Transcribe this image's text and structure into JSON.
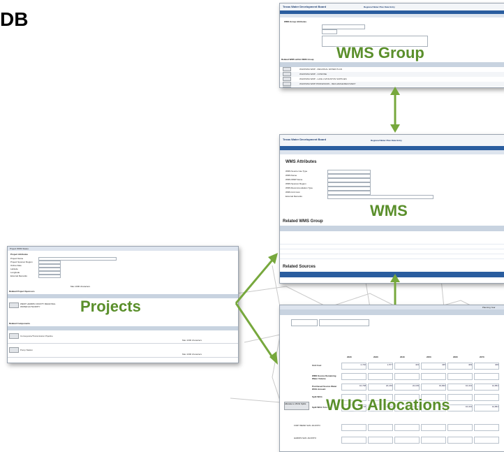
{
  "corner_text": "DB",
  "titles": {
    "wms_group": "WMS Group",
    "wms": "WMS",
    "projects": "Projects",
    "wug_allocations": "WUG Allocations"
  },
  "colors": {
    "accent": "#5a8f2b",
    "arrow": "#77a83d",
    "header_blue": "#1f3f73",
    "nav_blue": "#2a5d9f"
  },
  "wms_group_screen": {
    "app_title": "Regional Water Plan Data Entry",
    "logo": "Texas Water Development Board",
    "section": "WMS Group Attributes",
    "related_header": "Related WMS within WMS Group",
    "rows": [
      "WHOISWA WMP - REGIONAL WATER PLAN",
      "WHOISWA WMP - CONFINE",
      "WHOISWA WMP - LAKE LIVINGSTON SUPPLIES",
      "WHOISWA WMP PROFESSION - RECHARGE/RECOVERY",
      "WHOISWA WMP PROFESSION - SURFACE WATER DIVERSION"
    ]
  },
  "wms_screen": {
    "app_title": "Regional Water Plan Data Entry",
    "logo": "Texas Water Development Board",
    "section": "WMS Attributes",
    "related_group": "Related WMS Group",
    "related_sources": "Related Sources",
    "fields": [
      "WMS Source Use Type",
      "WMS Name",
      "WMS WMP Name",
      "WMS Sponsor Region",
      "WMS Recommendation Type",
      "WMS Unit Cost",
      "External Remarks"
    ]
  },
  "projects_screen": {
    "tab": "Project WMS Status",
    "section": "Project Attributes",
    "fields": [
      "Project Name",
      "Project Sponsor Region",
      "Online Date",
      "Latitude",
      "Longitude",
      "External Remarks"
    ],
    "project_name": "WEST HARRIS COUNTY REGIONAL WATER AUTHORITY",
    "related_sponsors": "Related Project Sponsors",
    "related_components": "Related Components",
    "components": [
      "Conveyance/Transmission Pipeline",
      "Pump Station"
    ],
    "chars_note": "Max 1000 characters"
  },
  "wug_screen": {
    "years": [
      "2020",
      "2030",
      "2040",
      "2050",
      "2060",
      "2070"
    ],
    "rows": [
      "Unit Cost",
      "WMS Source Remaining Water Volume",
      "Purchased Source Water WUG Amount",
      "Split WUG",
      "Split WUG Total"
    ],
    "unit_cost": [
      "2,740",
      "1,577",
      "443",
      "435",
      "409",
      "409"
    ],
    "purchased": [
      "16,738",
      "22,169",
      "22,169",
      "19,840",
      "16,313",
      "12,861"
    ],
    "split_total": [
      "16,738",
      "22,169",
      "22,169",
      "19,840",
      "16,313",
      "12,861"
    ],
    "owners": [
      "FORT BEND SAN JACINTO",
      "HARRIS SAN JACINTO"
    ],
    "button": "Allocate to WUG Splits",
    "planning_label": "Planning Year"
  }
}
